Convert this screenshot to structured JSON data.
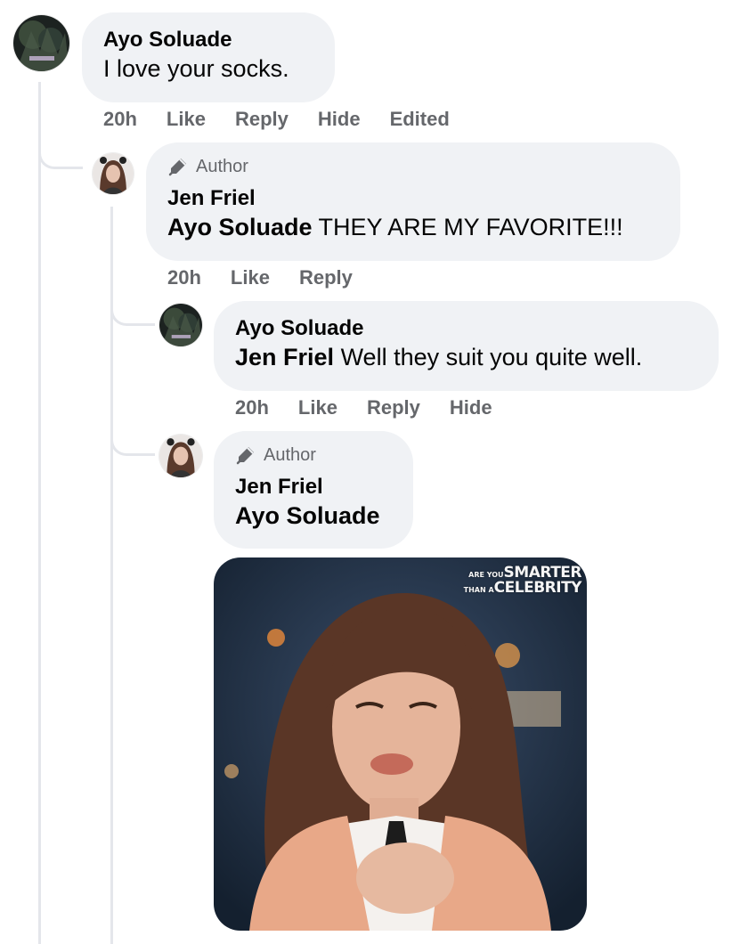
{
  "comments": [
    {
      "author": "Ayo Soluade",
      "text": "I love your socks.",
      "actions": {
        "time": "20h",
        "like": "Like",
        "reply": "Reply",
        "hide": "Hide",
        "edited": "Edited"
      }
    },
    {
      "badge": "Author",
      "author": "Jen Friel",
      "mention": "Ayo Soluade",
      "text": "THEY ARE MY FAVORITE!!!",
      "actions": {
        "time": "20h",
        "like": "Like",
        "reply": "Reply"
      }
    },
    {
      "author": "Ayo Soluade",
      "mention": "Jen Friel",
      "text": "Well they suit you quite well.",
      "actions": {
        "time": "20h",
        "like": "Like",
        "reply": "Reply",
        "hide": "Hide"
      }
    },
    {
      "badge": "Author",
      "author": "Jen Friel",
      "mention": "Ayo Soluade",
      "gif": {
        "watermark_small": "ARE YOU",
        "watermark_line1": "SMARTER",
        "watermark_small2": "THAN A",
        "watermark_line2": "CELEBRITY"
      }
    }
  ],
  "icons": {
    "author_badge": "pencil-microphone-icon"
  },
  "colors": {
    "bubble": "#f0f2f5",
    "meta": "#65676b",
    "text": "#050505",
    "thread": "#e4e6eb"
  }
}
